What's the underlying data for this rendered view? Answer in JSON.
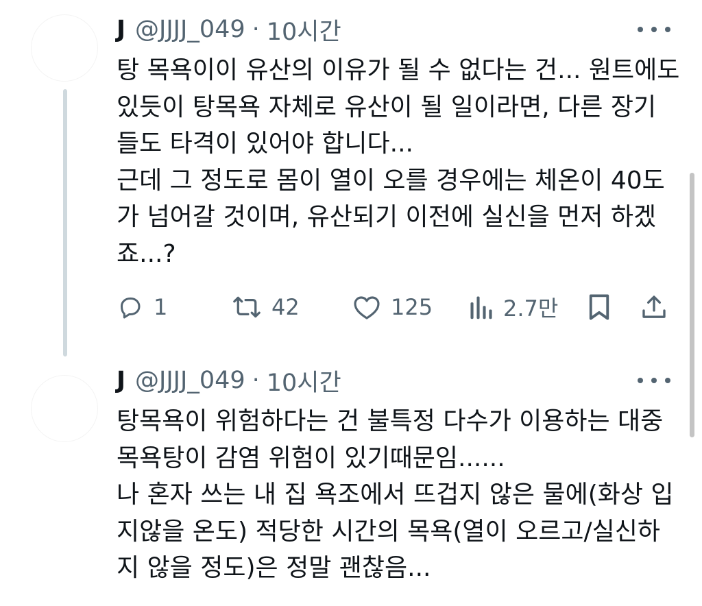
{
  "tweets": [
    {
      "name": "J",
      "handle": "@JJJJ_049",
      "separator": "·",
      "time": "10시간",
      "lines": [
        "탕 목욕이이 유산의 이유가 될 수 없다는 건... 원트에도",
        "있듯이 탕목욕 자체로 유산이 될 일이라면, 다른 장기",
        "들도 타격이 있어야 합니다...",
        "근데 그 정도로 몸이 열이 오를 경우에는 체온이 40도",
        "가 넘어갈 것이며, 유산되기 이전에 실신을 먼저 하겠",
        "죠...?"
      ],
      "replies": "1",
      "retweets": "42",
      "likes": "125",
      "views": "2.7만"
    },
    {
      "name": "J",
      "handle": "@JJJJ_049",
      "separator": "·",
      "time": "10시간",
      "lines": [
        "탕목욕이 위험하다는 건 불특정 다수가 이용하는 대중",
        "목욕탕이 감염 위험이 있기때문임......",
        "나 혼자 쓰는 내 집 욕조에서 뜨겁지 않은 물에(화상 입",
        "지않을 온도) 적당한 시간의 목욕(열이 오르고/실신하",
        "지 않을 정도)은 정말 괜찮음..."
      ]
    }
  ],
  "icons": {
    "more": "more-horizontal-icon",
    "reply": "reply-icon",
    "retweet": "retweet-icon",
    "like": "heart-icon",
    "views": "views-chart-icon",
    "bookmark": "bookmark-icon",
    "share": "share-icon"
  },
  "colors": {
    "text": "#0f1419",
    "secondary": "#536471",
    "thread_line": "#cfd9de"
  }
}
